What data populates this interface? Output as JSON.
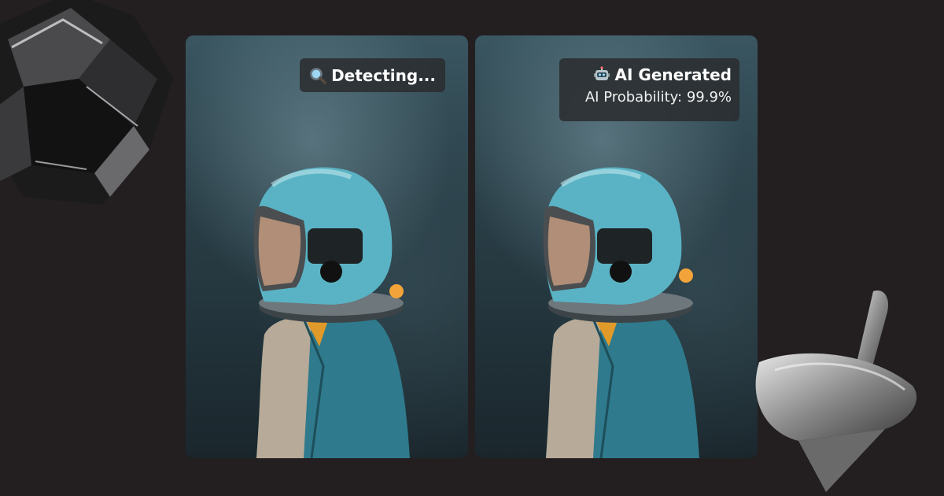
{
  "panels": {
    "left": {
      "badge_label": "Detecting...",
      "badge_icon": "magnifier-icon"
    },
    "right": {
      "badge_label": "AI Generated",
      "badge_icon": "robot-icon",
      "probability_text": "AI Probability: 99.9%"
    }
  },
  "colors": {
    "background": "#231f20",
    "badge_bg": "#2a2c2e",
    "helmet": "#5ab3c4",
    "jacket": "#2f7a8c"
  }
}
